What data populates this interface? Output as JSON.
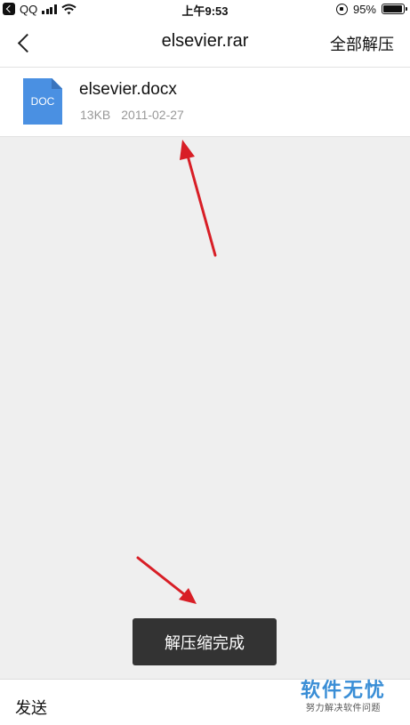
{
  "status_bar": {
    "carrier": "QQ",
    "time": "上午9:53",
    "battery_percent": "95%",
    "battery_level": 0.95,
    "icons": [
      "back-to-app-icon",
      "cellular-signal-icon",
      "wifi-icon",
      "rotation-lock-icon",
      "battery-icon"
    ]
  },
  "nav": {
    "title": "elsevier.rar",
    "action_label": "全部解压"
  },
  "files": [
    {
      "icon_label": "DOC",
      "name": "elsevier.docx",
      "size": "13KB",
      "date": "2011-02-27"
    }
  ],
  "toast": {
    "message": "解压缩完成"
  },
  "bottom_bar": {
    "send_label": "发送"
  },
  "watermark": {
    "main": "软件无忧",
    "sub": "努力解决软件问题"
  },
  "colors": {
    "annotation_arrow": "#d81e26",
    "doc_icon": "#4a90e2",
    "watermark": "#3a8ed6",
    "toast_bg": "#333333"
  }
}
